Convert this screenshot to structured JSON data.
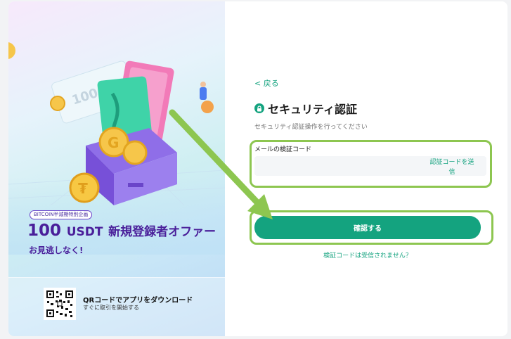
{
  "promo": {
    "badge": "BITCOIN半減期特別企画",
    "headline_amount": "100",
    "headline_unit": "USDT",
    "headline_rest": "新規登録者オファー",
    "subline": "お見逃しなく!",
    "coupon_text": "100",
    "qr_title": "QRコードでアプリをダウンロード",
    "qr_subtitle": "すぐに取引を開始する"
  },
  "form": {
    "back_label": "< 戻る",
    "title": "セキュリティ認証",
    "description": "セキュリティ認証操作を行ってください",
    "email_code_label": "メールの検証コード",
    "email_code_value": "",
    "send_code_line1": "認証コードを送",
    "send_code_line2": "信",
    "confirm_label": "確認する",
    "not_received_label": "検証コードは受信されません？"
  },
  "colors": {
    "accent": "#14a37f",
    "highlight": "#8dc650",
    "promo_text": "#4a1f9a"
  }
}
